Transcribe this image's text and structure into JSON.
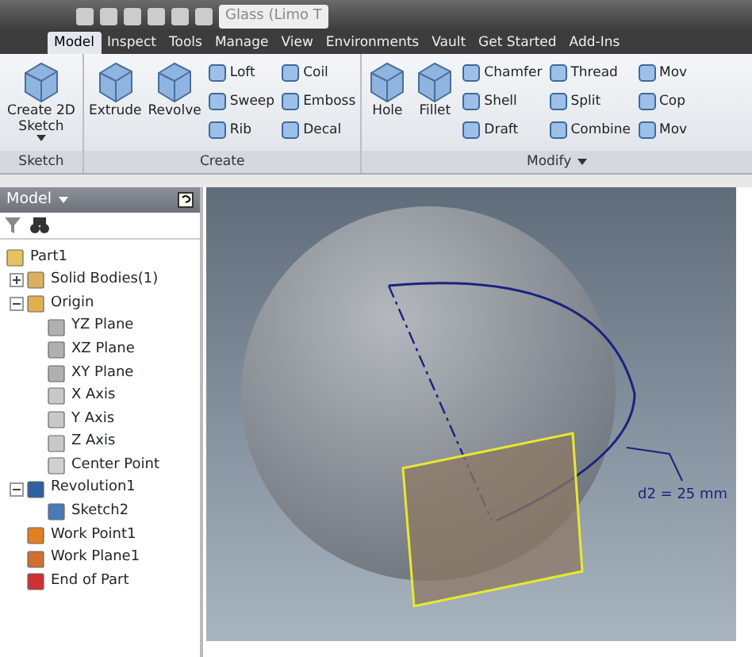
{
  "quick_access": {
    "document_title": "Glass (Limo T"
  },
  "tabs": [
    {
      "label": "Model",
      "selected": true
    },
    {
      "label": "Inspect",
      "selected": false
    },
    {
      "label": "Tools",
      "selected": false
    },
    {
      "label": "Manage",
      "selected": false
    },
    {
      "label": "View",
      "selected": false
    },
    {
      "label": "Environments",
      "selected": false
    },
    {
      "label": "Vault",
      "selected": false
    },
    {
      "label": "Get Started",
      "selected": false
    },
    {
      "label": "Add-Ins",
      "selected": false
    }
  ],
  "ribbon_panels": [
    {
      "title": "Sketch",
      "columns": [
        [
          {
            "label": "Create 2D Sketch",
            "kind": "large",
            "has_menu": true
          }
        ]
      ]
    },
    {
      "title": "Create",
      "columns": [
        [
          {
            "label": "Extrude",
            "kind": "large"
          }
        ],
        [
          {
            "label": "Revolve",
            "kind": "large"
          }
        ],
        [
          {
            "label": "Loft",
            "kind": "small"
          },
          {
            "label": "Sweep",
            "kind": "small"
          },
          {
            "label": "Rib",
            "kind": "small"
          }
        ],
        [
          {
            "label": "Coil",
            "kind": "small"
          },
          {
            "label": "Emboss",
            "kind": "small"
          },
          {
            "label": "Decal",
            "kind": "small"
          }
        ]
      ]
    },
    {
      "title": "Modify",
      "has_menu": true,
      "columns": [
        [
          {
            "label": "Hole",
            "kind": "large"
          }
        ],
        [
          {
            "label": "Fillet",
            "kind": "large"
          }
        ],
        [
          {
            "label": "Chamfer",
            "kind": "small"
          },
          {
            "label": "Shell",
            "kind": "small"
          },
          {
            "label": "Draft",
            "kind": "small"
          }
        ],
        [
          {
            "label": "Thread",
            "kind": "small"
          },
          {
            "label": "Split",
            "kind": "small"
          },
          {
            "label": "Combine",
            "kind": "small"
          }
        ],
        [
          {
            "label": "Mov",
            "kind": "small"
          },
          {
            "label": "Cop",
            "kind": "small"
          },
          {
            "label": "Mov",
            "kind": "small"
          }
        ]
      ]
    }
  ],
  "browser": {
    "title": "Model",
    "tree": [
      {
        "label": "Part1",
        "color": "#e8c060",
        "children": [
          {
            "label": "Solid Bodies(1)",
            "color": "#d8b060",
            "expanded": false
          },
          {
            "label": "Origin",
            "color": "#e0b050",
            "expanded": true,
            "children": [
              {
                "label": "YZ Plane",
                "color": "#b0b0b0"
              },
              {
                "label": "XZ Plane",
                "color": "#b0b0b0"
              },
              {
                "label": "XY Plane",
                "color": "#b0b0b0"
              },
              {
                "label": "X Axis",
                "color": "#c8c8c8"
              },
              {
                "label": "Y Axis",
                "color": "#c8c8c8"
              },
              {
                "label": "Z Axis",
                "color": "#c8c8c8"
              },
              {
                "label": "Center Point",
                "color": "#d0d0d0"
              }
            ]
          },
          {
            "label": "Revolution1",
            "color": "#3060a0",
            "expanded": true,
            "children": [
              {
                "label": "Sketch2",
                "color": "#4a7ab8"
              }
            ]
          },
          {
            "label": "Work Point1",
            "color": "#e08020"
          },
          {
            "label": "Work Plane1",
            "color": "#d07030"
          },
          {
            "label": "End of Part",
            "color": "#d03030"
          }
        ]
      }
    ]
  },
  "viewport": {
    "dimension": "d2 = 25 mm"
  }
}
